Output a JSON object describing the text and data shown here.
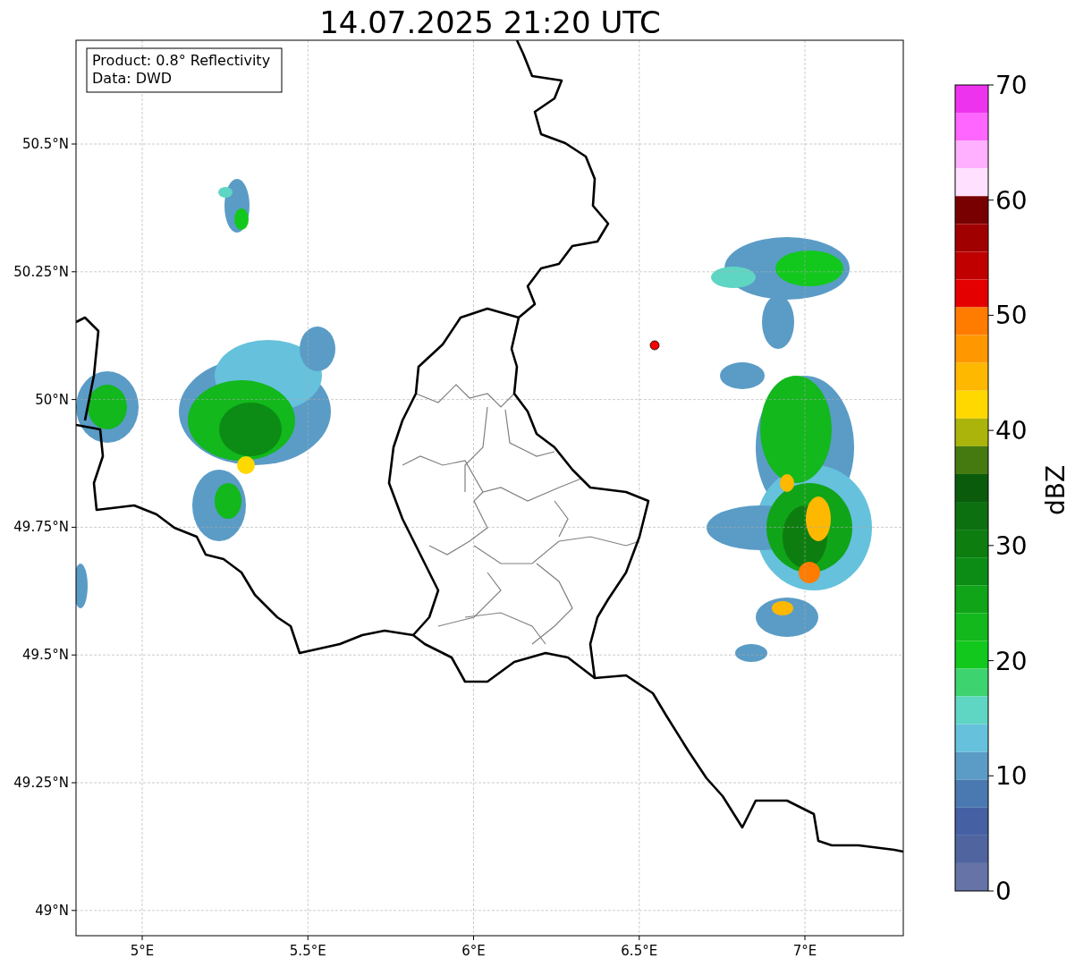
{
  "title": "14.07.2025 21:20 UTC",
  "info_box": [
    "Product: 0.8° Reflectivity",
    "Data: DWD"
  ],
  "map": {
    "xticks": [
      "5°E",
      "5.5°E",
      "6°E",
      "6.5°E",
      "7°E"
    ],
    "yticks": [
      "50.5°N",
      "50.25°N",
      "50°N",
      "49.75°N",
      "49.5°N",
      "49.25°N",
      "49°N"
    ]
  },
  "colorbar": {
    "label": "dBZ",
    "ticks": [
      "70",
      "60",
      "50",
      "40",
      "30",
      "20",
      "10",
      "0"
    ],
    "segments": [
      {
        "color": "#ee33ee"
      },
      {
        "color": "#ff66ff"
      },
      {
        "color": "#ffb0ff"
      },
      {
        "color": "#ffe0ff"
      },
      {
        "color": "#780000"
      },
      {
        "color": "#a00000"
      },
      {
        "color": "#c00000"
      },
      {
        "color": "#e40000"
      },
      {
        "color": "#ff7c00"
      },
      {
        "color": "#ff9800"
      },
      {
        "color": "#ffb800"
      },
      {
        "color": "#ffd800"
      },
      {
        "color": "#aab40a"
      },
      {
        "color": "#457a10"
      },
      {
        "color": "#0a5c0c"
      },
      {
        "color": "#0c6f10"
      },
      {
        "color": "#0e7d10"
      },
      {
        "color": "#0c8c14"
      },
      {
        "color": "#10a418"
      },
      {
        "color": "#12b81c"
      },
      {
        "color": "#12c81c"
      },
      {
        "color": "#3dd46f"
      },
      {
        "color": "#5ed6c3"
      },
      {
        "color": "#66c1dc"
      },
      {
        "color": "#5a9cc6"
      },
      {
        "color": "#4a78b0"
      },
      {
        "color": "#4560a3"
      },
      {
        "color": "#5065a0"
      },
      {
        "color": "#6573a6"
      }
    ]
  }
}
